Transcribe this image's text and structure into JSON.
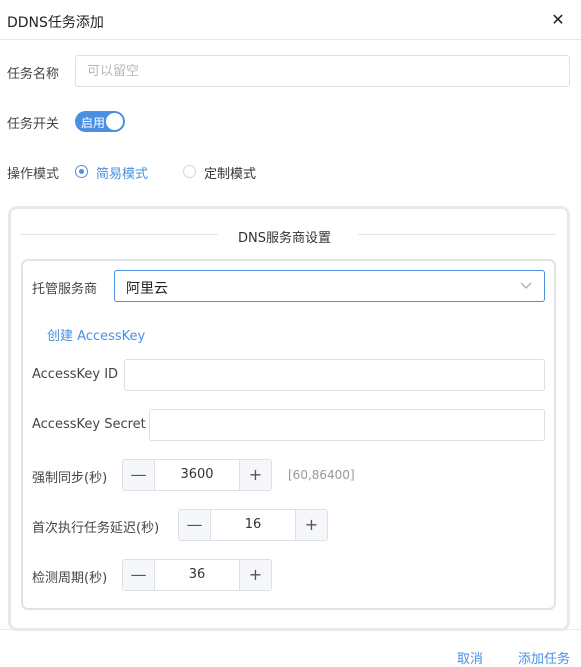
{
  "dialog": {
    "title": "DDNS任务添加",
    "close_glyph": "✕"
  },
  "form": {
    "task_name": {
      "label": "任务名称",
      "value": "",
      "placeholder": "可以留空"
    },
    "task_switch": {
      "label": "任务开关",
      "state_text": "启用",
      "enabled": true
    },
    "mode": {
      "label": "操作模式",
      "options": [
        {
          "label": "简易模式",
          "checked": true
        },
        {
          "label": "定制模式",
          "checked": false
        }
      ]
    }
  },
  "dns_section": {
    "title": "DNS服务商设置",
    "provider": {
      "label": "托管服务商",
      "selected": "阿里云"
    },
    "create_key_link": "创建 AccessKey",
    "access_key_id": {
      "label": "AccessKey ID",
      "value": ""
    },
    "access_key_secret": {
      "label": "AccessKey Secret",
      "value": ""
    },
    "force_sync": {
      "label": "强制同步(秒)",
      "value": "3600",
      "hint": "[60,86400]"
    },
    "first_delay": {
      "label": "首次执行任务延迟(秒)",
      "value": "16"
    },
    "check_period": {
      "label": "检测周期(秒)",
      "value": "36"
    },
    "minus_glyph": "—",
    "plus_glyph": "+"
  },
  "footer": {
    "cancel_label": "取消",
    "submit_label": "添加任务"
  },
  "colors": {
    "accent": "#4a90e2",
    "border": "#dcdfe6"
  }
}
